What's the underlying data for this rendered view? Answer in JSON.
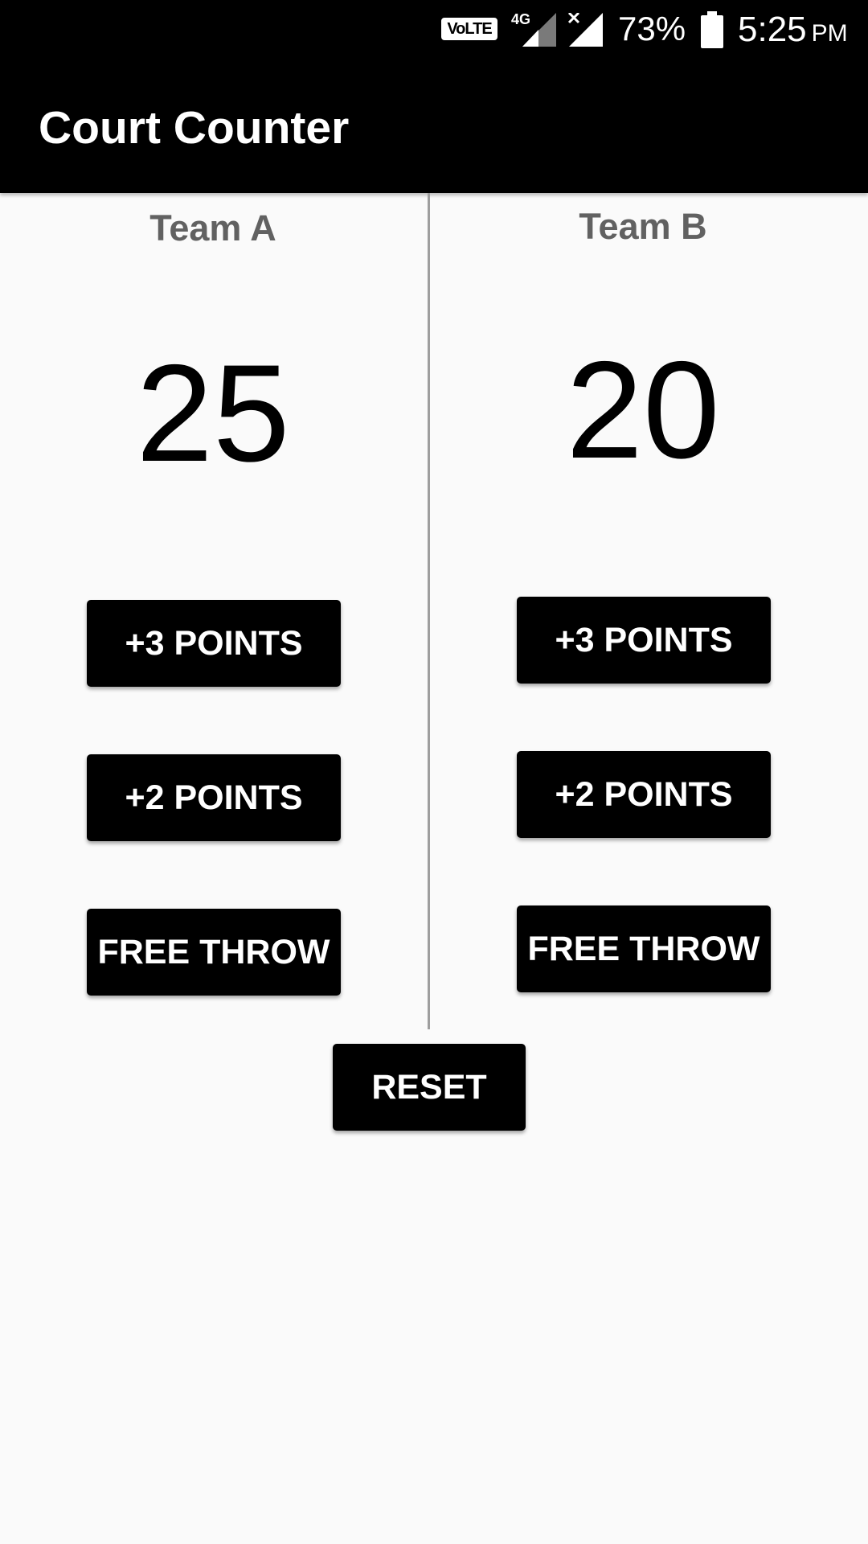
{
  "status_bar": {
    "volte": "VoLTE",
    "network": "4G",
    "battery_percent": "73%",
    "time": "5:25",
    "ampm": "PM"
  },
  "app_bar": {
    "title": "Court Counter"
  },
  "team_a": {
    "name": "Team A",
    "score": "25",
    "buttons": {
      "three": "+3 POINTS",
      "two": "+2 POINTS",
      "free_throw": "FREE THROW"
    }
  },
  "team_b": {
    "name": "Team B",
    "score": "20",
    "buttons": {
      "three": "+3 POINTS",
      "two": "+2 POINTS",
      "free_throw": "FREE THROW"
    }
  },
  "reset_label": "RESET",
  "colors": {
    "app_bar": "#000000",
    "button": "#000000",
    "background": "#fafafa",
    "team_label": "#616161",
    "divider": "#9e9e9e"
  }
}
